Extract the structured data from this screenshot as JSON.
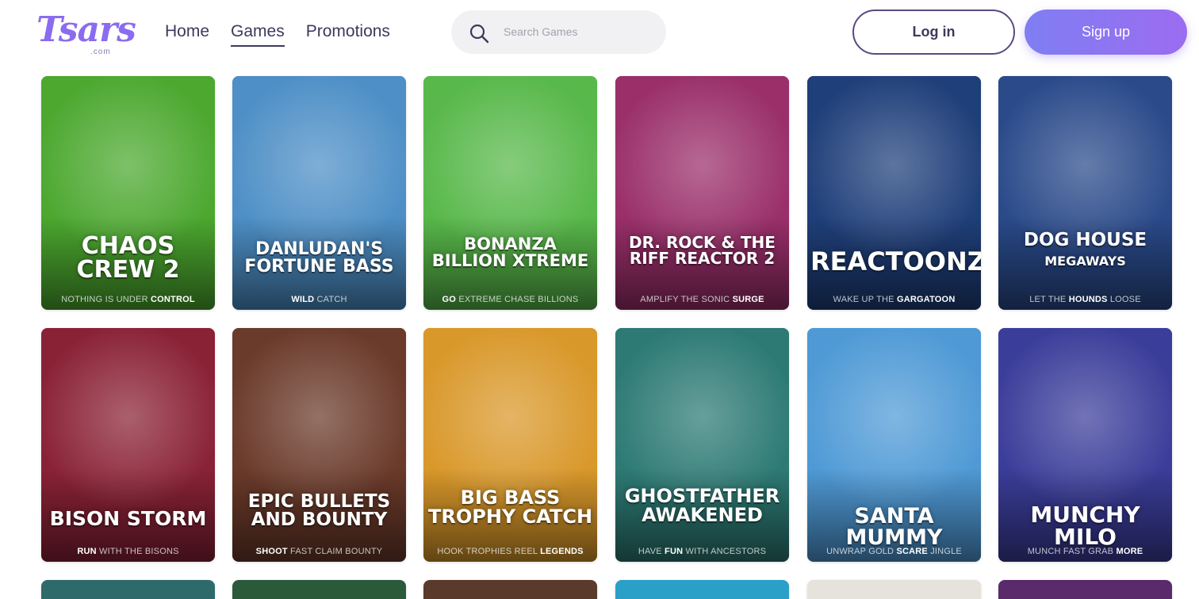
{
  "header": {
    "logo": {
      "text": "Tsars",
      "sub": ".com"
    },
    "nav": [
      {
        "label": "Home",
        "active": false
      },
      {
        "label": "Games",
        "active": true
      },
      {
        "label": "Promotions",
        "active": false
      }
    ],
    "search": {
      "placeholder": "Search Games",
      "icon": "search-icon"
    },
    "login_label": "Log in",
    "signup_label": "Sign up",
    "colors": {
      "accent": "#8b6cf0",
      "signup_from": "#7f7ef3",
      "signup_to": "#9c6cf0"
    }
  },
  "games": [
    {
      "title": "CHAOS CREW 2",
      "tag_pre": "NOTHING IS UNDER ",
      "tag_bold": "CONTROL",
      "tag_post": "",
      "bg": "#4ca82f"
    },
    {
      "title": "DANLUDAN'S FORTUNE BASS",
      "tag_pre": "",
      "tag_bold": "WILD",
      "tag_post": " CATCH",
      "bg": "#4d8fc6"
    },
    {
      "title": "BONANZA BILLION XTREME",
      "tag_pre": "",
      "tag_bold": "GO",
      "tag_post": " EXTREME CHASE BILLIONS",
      "bg": "#58b84a"
    },
    {
      "title": "DR. ROCK & THE RIFF REACTOR 2",
      "tag_pre": "AMPLIFY THE SONIC ",
      "tag_bold": "SURGE",
      "tag_post": "",
      "bg": "#9a2f6a"
    },
    {
      "title": "REACTOONZ",
      "tag_pre": "WAKE UP THE ",
      "tag_bold": "GARGATOON",
      "tag_post": "",
      "bg": "#1f3f7a"
    },
    {
      "title": "DOG HOUSE",
      "subtitle": "MEGAWAYS",
      "tag_pre": "LET THE ",
      "tag_bold": "HOUNDS",
      "tag_post": " LOOSE",
      "bg": "#2a4a8a"
    },
    {
      "title": "BISON STORM",
      "tag_pre": "",
      "tag_bold": "RUN",
      "tag_post": " WITH THE BISONS",
      "bg": "#8a2236"
    },
    {
      "title": "EPIC BULLETS AND BOUNTY",
      "tag_pre": "",
      "tag_bold": "SHOOT",
      "tag_post": " FAST CLAIM BOUNTY",
      "bg": "#6a3a2a"
    },
    {
      "title": "BIG BASS TROPHY CATCH",
      "tag_pre": "HOOK TROPHIES REEL ",
      "tag_bold": "LEGENDS",
      "tag_post": "",
      "bg": "#d9982a"
    },
    {
      "title": "GHOSTFATHER AWAKENED",
      "tag_pre": "HAVE ",
      "tag_bold": "FUN",
      "tag_post": " WITH ANCESTORS",
      "bg": "#2d7a74"
    },
    {
      "title": "SANTA MUMMY",
      "tag_pre": "UNWRAP GOLD ",
      "tag_bold": "SCARE",
      "tag_post": " JINGLE",
      "bg": "#4f9ad6"
    },
    {
      "title": "MUNCHY MILO",
      "tag_pre": "MUNCH FAST GRAB ",
      "tag_bold": "MORE",
      "tag_post": "",
      "bg": "#3b3d9a"
    }
  ]
}
